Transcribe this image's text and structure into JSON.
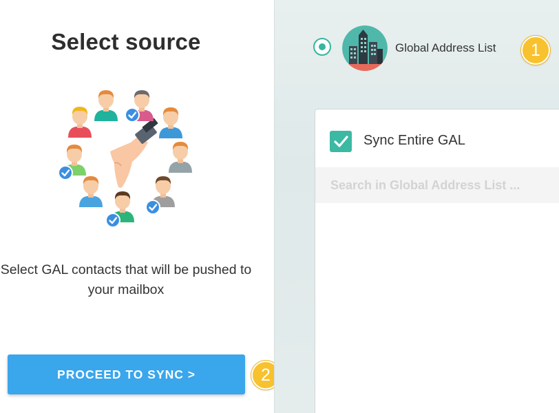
{
  "left": {
    "title": "Select source",
    "description": "Select GAL contacts that will be pushed to your mailbox",
    "proceed_button": "PROCEED TO SYNC >"
  },
  "badges": {
    "step1": "1",
    "step2": "2"
  },
  "source": {
    "selected": true,
    "label": "Global Address List",
    "avatar_icon": "city-buildings-icon"
  },
  "gal_card": {
    "sync_entire_label": "Sync Entire GAL",
    "sync_entire_checked": true,
    "search_placeholder": "Search in Global Address List ...",
    "search_value": ""
  },
  "illustration": {
    "icon": "contacts-selection-illustration",
    "checked_contacts": 5,
    "total_contacts": 10
  },
  "colors": {
    "accent_teal": "#35b6a0",
    "button_blue": "#3aa6ec",
    "badge_yellow": "#f8c12e",
    "check_blue": "#3a8fe0"
  }
}
